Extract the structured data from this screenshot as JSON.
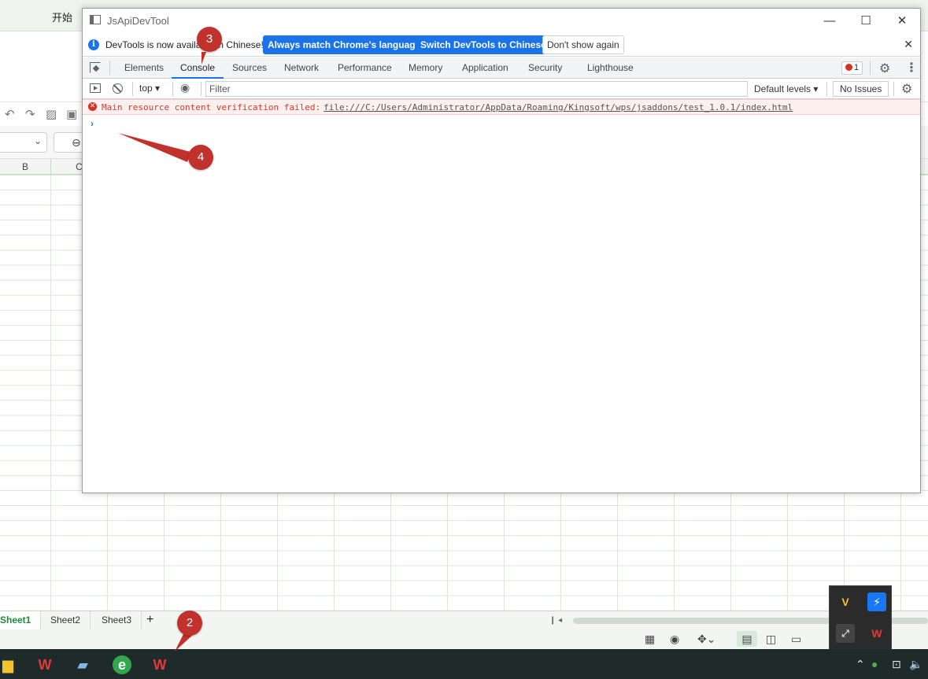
{
  "wps": {
    "ribbon_tab_start": "开始",
    "columns": [
      "B",
      "C"
    ],
    "sheet_tabs": [
      "Sheet1",
      "Sheet2",
      "Sheet3"
    ],
    "sheet_add": "+"
  },
  "devtools": {
    "window_title": "JsApiDevTool",
    "infobar": {
      "text": "DevTools is now available in Chinese!",
      "btn_match": "Always match Chrome's language",
      "btn_switch": "Switch DevTools to Chinese",
      "btn_dismiss": "Don't show again"
    },
    "tabs": [
      "Elements",
      "Console",
      "Sources",
      "Network",
      "Performance",
      "Memory",
      "Application",
      "Security",
      "Lighthouse"
    ],
    "active_tab": "Console",
    "error_count": "1",
    "toolbar": {
      "context": "top",
      "filter_placeholder": "Filter",
      "levels": "Default levels",
      "issues": "No Issues"
    },
    "console": {
      "error_message": "Main resource content verification failed:",
      "error_link": "file:///C:/Users/Administrator/AppData/Roaming/Kingsoft/wps/jsaddons/test_1.0.1/index.html",
      "prompt": "›"
    }
  },
  "markers": [
    "2",
    "3",
    "4"
  ],
  "colors": {
    "accent": "#1a73e8",
    "error": "#d93025",
    "marker": "#c0322b",
    "taskbar": "#1f2a2a"
  }
}
